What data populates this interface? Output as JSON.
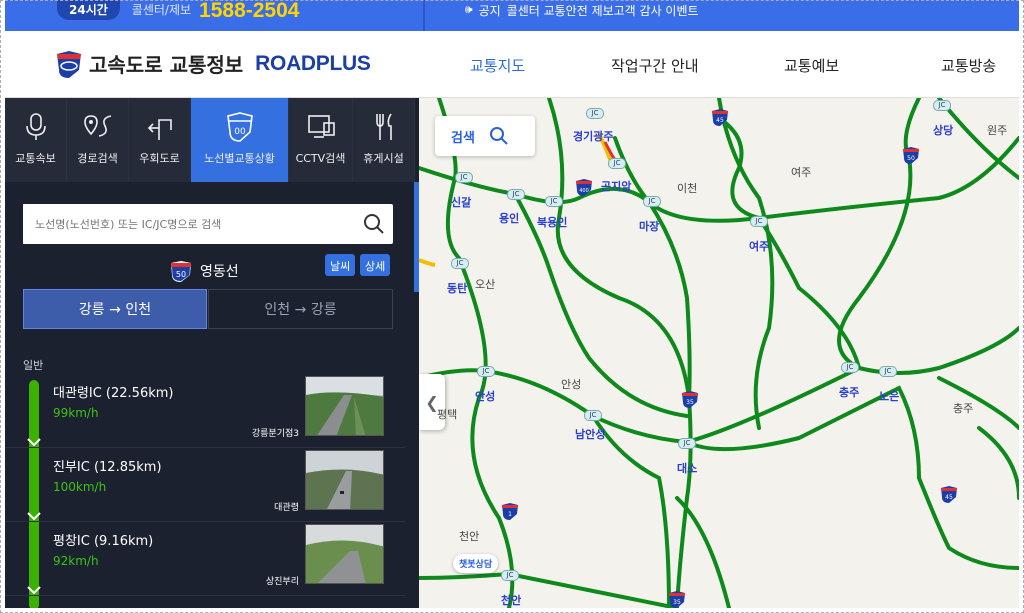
{
  "topbar": {
    "badge": "24시간",
    "callcenter": "콜센터/제보",
    "phone": "1588-2504",
    "notice_label": "공지",
    "notice_text": "콜센터 교통안전 제보고객 감사 이벤트"
  },
  "header": {
    "logo_ko": "고속도로 교통정보",
    "logo_en": "ROADPLUS",
    "nav": [
      "교통지도",
      "작업구간 안내",
      "교통예보",
      "교통방송"
    ]
  },
  "sidebar": {
    "tabs": [
      "교통속보",
      "경로검색",
      "우회도로",
      "노선별교통상황",
      "CCTV검색",
      "휴게시설"
    ],
    "search_placeholder": "노선명(노선번호) 또는 IC/JC명으로 검색",
    "route_number": "50",
    "route_name": "영동선",
    "weather_btn": "날씨",
    "detail_btn": "상세",
    "dir_active": "강릉 → 인천",
    "dir_inactive": "인천 → 강릉",
    "section_label": "일반",
    "entries": [
      {
        "name": "대관령IC (22.56km)",
        "speed": "99km/h",
        "cctv": "강릉분기점3"
      },
      {
        "name": "진부IC (12.85km)",
        "speed": "100km/h",
        "cctv": "대관령"
      },
      {
        "name": "평창IC (9.16km)",
        "speed": "92km/h",
        "cctv": "상진부리"
      }
    ]
  },
  "map": {
    "search_label": "검색",
    "chat_label": "챗봇상담",
    "jc_text": "JC",
    "ic_labels": [
      "경기광주",
      "곤지암",
      "이천",
      "신갈",
      "용인",
      "용인",
      "북용인",
      "마장",
      "여주",
      "동탄",
      "오산",
      "안성",
      "남안성",
      "충주",
      "노은",
      "대소",
      "천안",
      "천안",
      "평택",
      "안성",
      "상당",
      "원주",
      "충주",
      "여주"
    ],
    "shields": [
      "45",
      "50",
      "400",
      "35",
      "45",
      "1",
      "35"
    ],
    "colors": {
      "road": "#0e8a1c",
      "road_slow": "#f0c000"
    }
  }
}
